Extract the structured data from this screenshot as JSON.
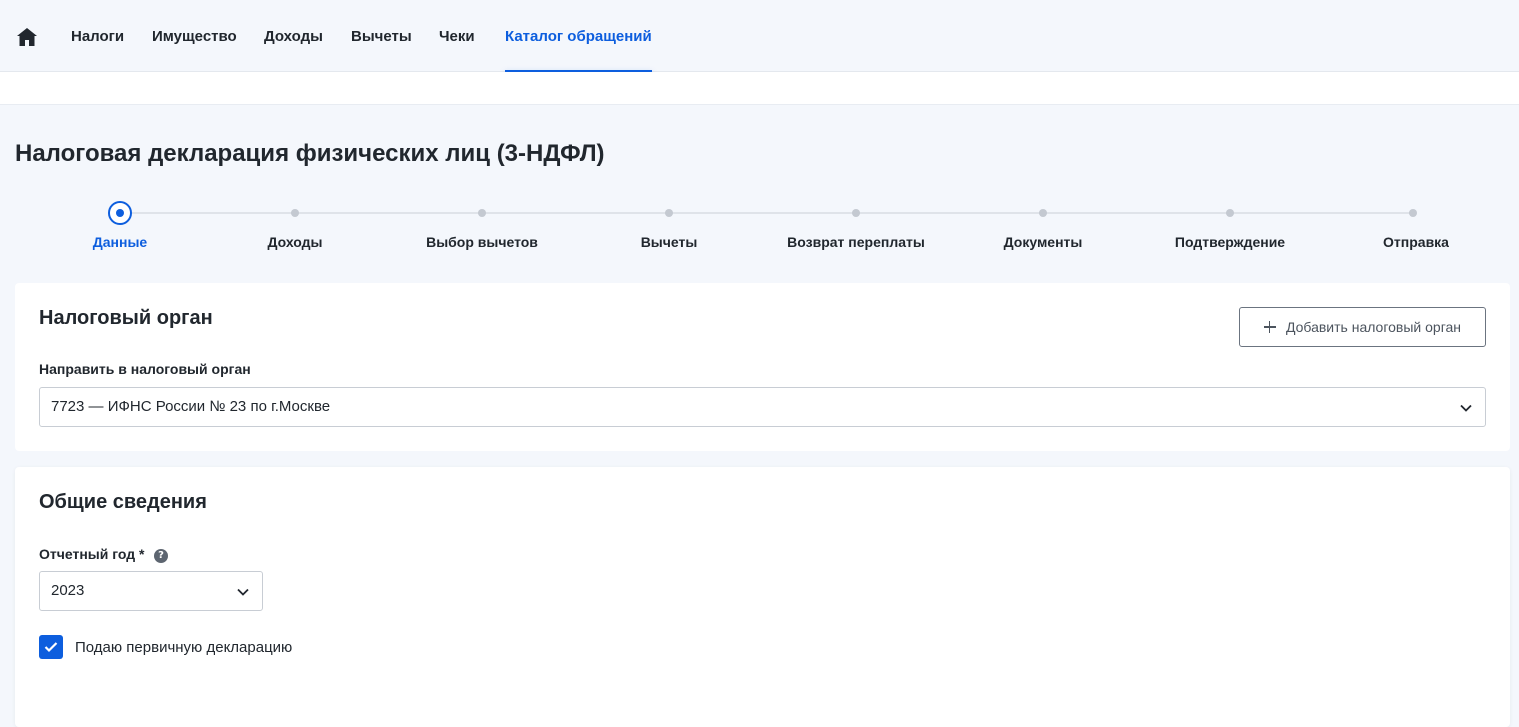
{
  "nav": {
    "items": [
      {
        "label": "Налоги",
        "active": false
      },
      {
        "label": "Имущество",
        "active": false
      },
      {
        "label": "Доходы",
        "active": false
      },
      {
        "label": "Вычеты",
        "active": false
      },
      {
        "label": "Чеки",
        "active": false
      },
      {
        "label": "Каталог обращений",
        "active": true
      }
    ]
  },
  "page": {
    "title": "Налоговая декларация физических лиц (3-НДФЛ)"
  },
  "stepper": {
    "steps": [
      {
        "label": "Данные",
        "current": true
      },
      {
        "label": "Доходы",
        "current": false
      },
      {
        "label": "Выбор вычетов",
        "current": false
      },
      {
        "label": "Вычеты",
        "current": false
      },
      {
        "label": "Возврат переплаты",
        "current": false
      },
      {
        "label": "Документы",
        "current": false
      },
      {
        "label": "Подтверждение",
        "current": false
      },
      {
        "label": "Отправка",
        "current": false
      }
    ]
  },
  "tax_authority": {
    "title": "Налоговый орган",
    "add_button_label": "Добавить налоговый орган",
    "field_label": "Направить в налоговый орган",
    "selected_value": "7723 — ИФНС России № 23 по г.Москве"
  },
  "general_info": {
    "title": "Общие сведения",
    "year_label": "Отчетный год *",
    "year_value": "2023",
    "primary_checkbox_label": "Подаю первичную декларацию",
    "primary_checked": true
  },
  "colors": {
    "accent": "#0d5ede",
    "text": "#21272e",
    "background": "#f4f7fc"
  }
}
